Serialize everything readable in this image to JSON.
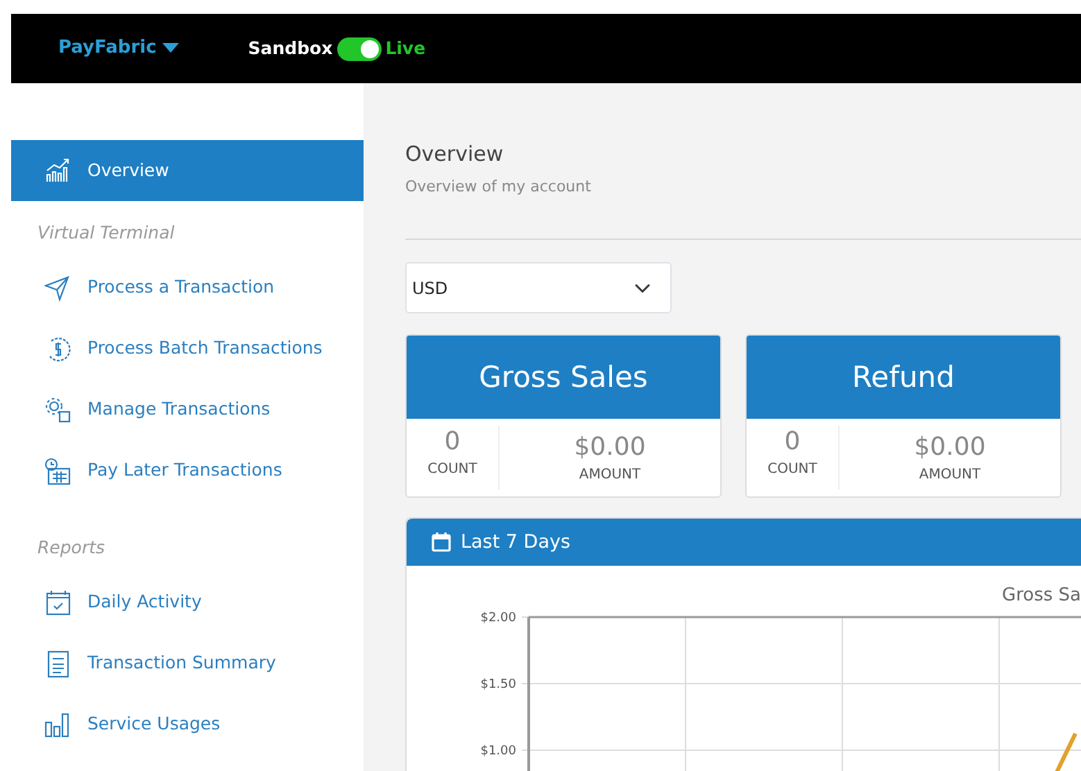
{
  "topbar": {
    "brand": "PayFabric",
    "mode_switch": {
      "left_label": "Sandbox",
      "right_label": "Live",
      "on": true
    }
  },
  "sidebar": {
    "sections": [
      {
        "items": [
          {
            "label": "Overview",
            "selected": true
          }
        ]
      },
      {
        "heading": "Virtual Terminal",
        "items": [
          {
            "label": "Process a Transaction",
            "selected": false
          },
          {
            "label": "Process Batch Transactions",
            "selected": false
          },
          {
            "label": "Manage Transactions",
            "selected": false
          },
          {
            "label": "Pay Later Transactions",
            "selected": false
          }
        ]
      },
      {
        "heading": "Reports",
        "items": [
          {
            "label": "Daily Activity",
            "selected": false
          },
          {
            "label": "Transaction Summary",
            "selected": false
          },
          {
            "label": "Service Usages",
            "selected": false
          }
        ]
      }
    ]
  },
  "page": {
    "title": "Overview",
    "subtitle": "Overview of my account"
  },
  "currency_select": {
    "value": "USD"
  },
  "summary_cards": [
    {
      "title": "Gross Sales",
      "count": "0",
      "count_label": "COUNT",
      "amount": "$0.00",
      "amount_label": "AMOUNT"
    },
    {
      "title": "Refund",
      "count": "0",
      "count_label": "COUNT",
      "amount": "$0.00",
      "amount_label": "AMOUNT"
    }
  ],
  "chart_panel": {
    "title": "Last 7 Days",
    "chart_title": "Gross Sa",
    "y_labels": [
      "$2.00",
      "$1.50",
      "$1.00"
    ]
  }
}
